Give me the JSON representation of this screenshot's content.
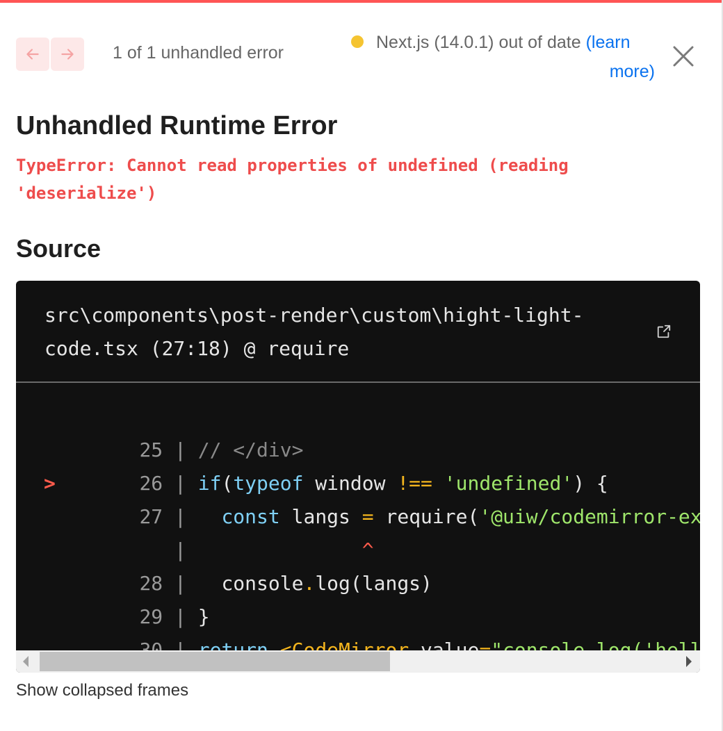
{
  "colors": {
    "accent_border": "#ff5555",
    "error_text": "#ee4c4c",
    "link": "#0a72ef",
    "status_dot": "#f5c431",
    "code_bg": "#111111"
  },
  "header": {
    "prev_icon": "arrow-left-icon",
    "next_icon": "arrow-right-icon",
    "error_count": "1 of 1 unhandled error",
    "version_text": "Next.js (14.0.1) out of date",
    "learn_more_part1": "(learn",
    "learn_more_part2": "more)",
    "close_icon": "close-icon"
  },
  "error": {
    "title": "Unhandled Runtime Error",
    "message": "TypeError: Cannot read properties of undefined (reading 'deserialize')"
  },
  "source": {
    "heading": "Source",
    "file_line1": "src\\components\\post-render\\custom\\hight-light-",
    "file_line2": "code.tsx (27:18) @ require",
    "open_icon": "external-link-icon",
    "lines": [
      {
        "num": "25",
        "code": "// </div>"
      },
      {
        "num": "26",
        "code": "if(typeof window !== 'undefined') {"
      },
      {
        "num": "27",
        "code": "  const langs = require('@uiw/codemirror-extens",
        "active": true,
        "marker": ">"
      },
      {
        "num": "",
        "code": "^"
      },
      {
        "num": "28",
        "code": "  console.log(langs)"
      },
      {
        "num": "29",
        "code": "}"
      },
      {
        "num": "30",
        "code": "return <CodeMirror value=\"console.log('hello wo"
      }
    ]
  },
  "footer": {
    "collapsed_frames": "Show collapsed frames"
  }
}
